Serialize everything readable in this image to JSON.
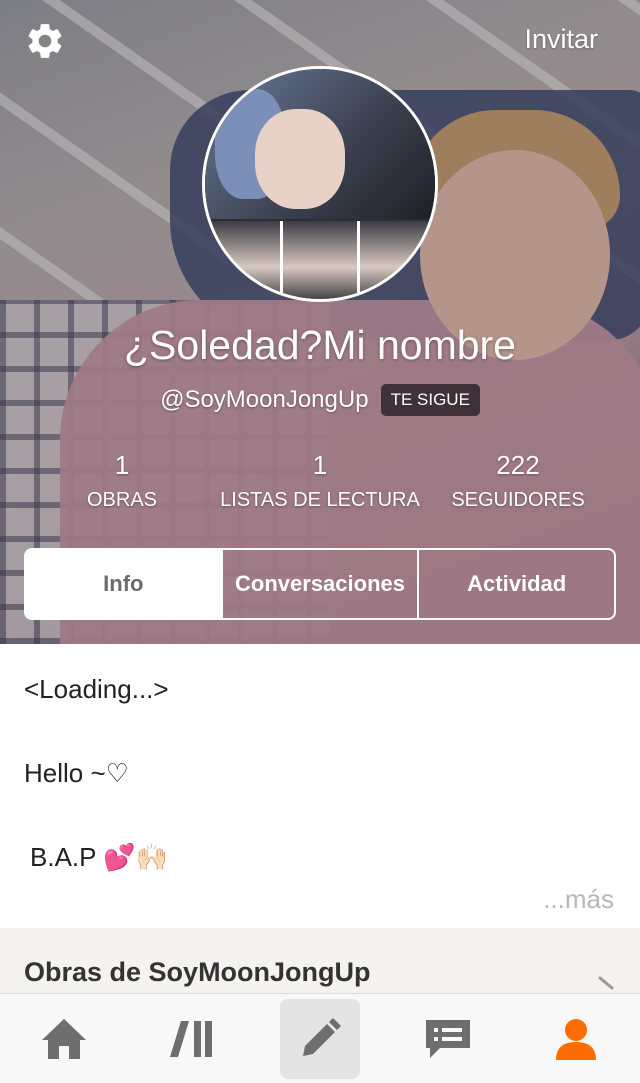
{
  "header": {
    "settings_icon": "gear-icon",
    "invite_label": "Invitar"
  },
  "profile": {
    "display_name": "¿Soledad?Mi nombre",
    "handle": "@SoyMoonJongUp",
    "follows_you_badge": "TE SIGUE"
  },
  "stats": [
    {
      "value": "1",
      "label": "OBRAS"
    },
    {
      "value": "1",
      "label": "LISTAS DE LECTURA"
    },
    {
      "value": "222",
      "label": "SEGUIDORES"
    }
  ],
  "tabs": [
    {
      "label": "Info",
      "active": true
    },
    {
      "label": "Conversaciones",
      "active": false
    },
    {
      "label": "Actividad",
      "active": false
    }
  ],
  "about": {
    "lines": [
      "<Loading...>",
      "Hello ~♡",
      "B.A.P 💕🙌🏻"
    ],
    "more_label": "...más"
  },
  "works": {
    "title": "Obras de SoyMoonJongUp"
  },
  "bottom_nav": {
    "items": [
      "home-icon",
      "library-icon",
      "write-icon",
      "messages-icon",
      "profile-icon"
    ],
    "accent_color": "#ff6c00",
    "icon_color": "#6e6e6e"
  }
}
